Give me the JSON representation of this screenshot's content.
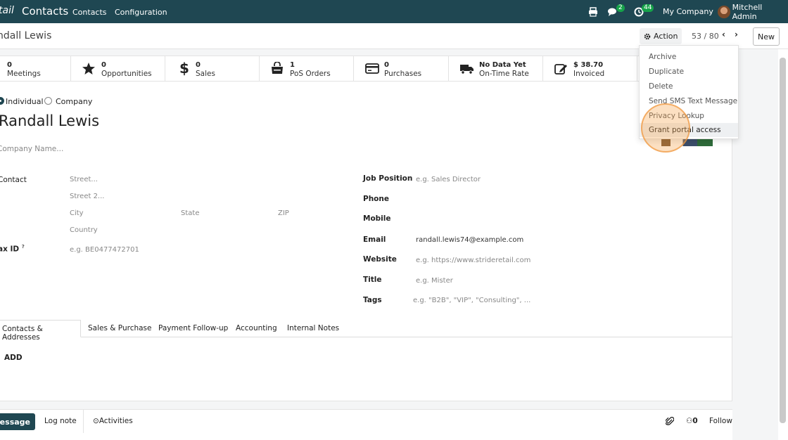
{
  "navbar": {
    "app_partial": "tail",
    "app_title": "Contacts",
    "menu": [
      "Contacts",
      "Configuration"
    ],
    "messages_badge": "2",
    "activities_badge": "44",
    "company": "My Company",
    "user": "Mitchell Admin"
  },
  "control_panel": {
    "breadcrumb": "ndall Lewis",
    "action_label": "Action",
    "pager": "53 / 80",
    "new_label": "New"
  },
  "stats": [
    {
      "num": "0",
      "label": "Meetings",
      "icon": "calendar-icon"
    },
    {
      "num": "0",
      "label": "Opportunities",
      "icon": "star-icon"
    },
    {
      "num": "0",
      "label": "Sales",
      "icon": "dollar-icon"
    },
    {
      "num": "1",
      "label": "PoS Orders",
      "icon": "shopping-bag-icon"
    },
    {
      "num": "0",
      "label": "Purchases",
      "icon": "credit-card-icon"
    },
    {
      "num": "No Data Yet",
      "label": "On-Time Rate",
      "icon": "truck-icon"
    },
    {
      "num": "$ 38.70",
      "label": "Invoiced",
      "icon": "pencil-square-icon"
    }
  ],
  "form": {
    "type_individual": "Individual",
    "type_company": "Company",
    "name": "Randall Lewis",
    "company_placeholder": "Company Name...",
    "contact_label": "Contact",
    "street_ph": "Street...",
    "street2_ph": "Street 2...",
    "city_ph": "City",
    "state_ph": "State",
    "zip_ph": "ZIP",
    "country_ph": "Country",
    "tax_label": "ax ID",
    "tax_help": "?",
    "tax_ph": "e.g. BE0477472701",
    "job_label": "Job Position",
    "job_ph": "e.g. Sales Director",
    "phone_label": "Phone",
    "mobile_label": "Mobile",
    "email_label": "Email",
    "email_value": "randall.lewis74@example.com",
    "website_label": "Website",
    "website_ph": "e.g. https://www.strideretail.com",
    "title_label": "Title",
    "title_ph": "e.g. Mister",
    "tags_label": "Tags",
    "tags_ph": "e.g. \"B2B\", \"VIP\", \"Consulting\", ..."
  },
  "tabs": [
    "Contacts & Addresses",
    "Sales & Purchase",
    "Payment Follow-up",
    "Accounting",
    "Internal Notes"
  ],
  "add_label": "ADD",
  "chatter": {
    "send": "message",
    "log_note": "Log note",
    "activities": "Activities",
    "followers_count": "0",
    "follow": "Follow"
  },
  "action_menu": [
    "Archive",
    "Duplicate",
    "Delete",
    "Send SMS Text Message",
    "Privacy Lookup",
    "Grant portal access"
  ],
  "colors": {
    "navbar": "#1f4752",
    "badge": "#16a34a",
    "highlight": "#f5a650"
  }
}
